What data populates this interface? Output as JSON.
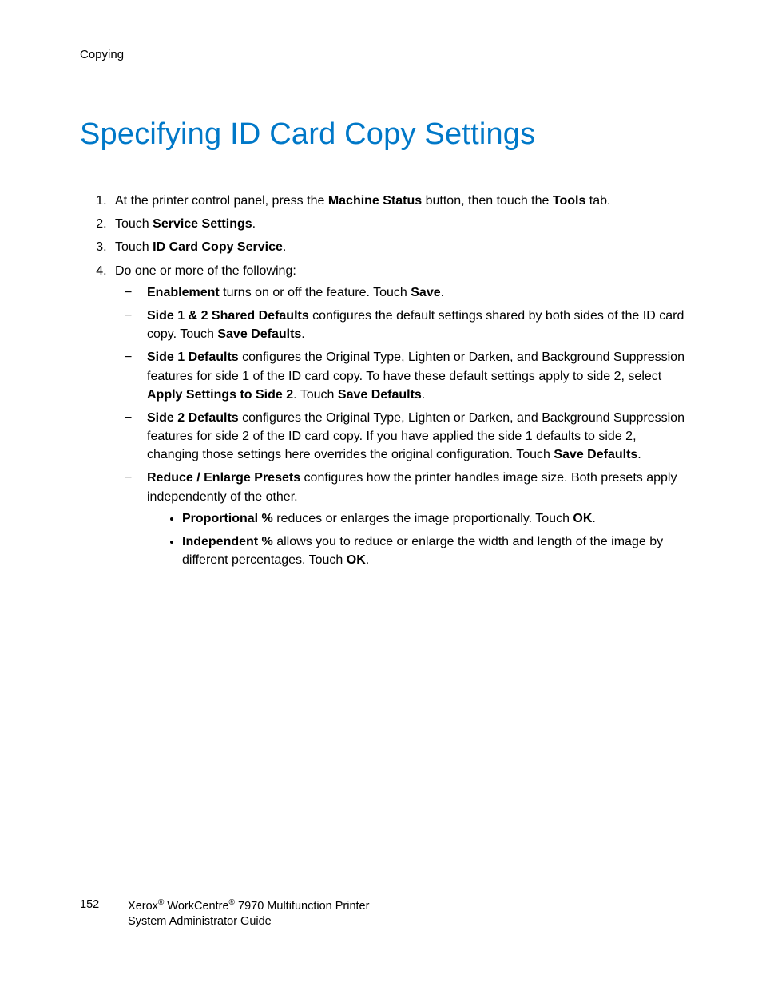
{
  "header": {
    "section": "Copying"
  },
  "title": "Specifying ID Card Copy Settings",
  "steps": [
    {
      "parts": [
        {
          "t": "plain",
          "v": "At the printer control panel, press the "
        },
        {
          "t": "b",
          "v": "Machine Status"
        },
        {
          "t": "plain",
          "v": " button, then touch the "
        },
        {
          "t": "b",
          "v": "Tools"
        },
        {
          "t": "plain",
          "v": " tab."
        }
      ]
    },
    {
      "parts": [
        {
          "t": "plain",
          "v": "Touch "
        },
        {
          "t": "b",
          "v": "Service Settings"
        },
        {
          "t": "plain",
          "v": "."
        }
      ]
    },
    {
      "parts": [
        {
          "t": "plain",
          "v": "Touch "
        },
        {
          "t": "b",
          "v": "ID Card Copy Service"
        },
        {
          "t": "plain",
          "v": "."
        }
      ]
    },
    {
      "parts": [
        {
          "t": "plain",
          "v": "Do one or more of the following:"
        }
      ],
      "dash": [
        {
          "parts": [
            {
              "t": "b",
              "v": "Enablement"
            },
            {
              "t": "plain",
              "v": " turns on or off the feature. Touch "
            },
            {
              "t": "b",
              "v": "Save"
            },
            {
              "t": "plain",
              "v": "."
            }
          ]
        },
        {
          "parts": [
            {
              "t": "b",
              "v": "Side 1 & 2 Shared Defaults"
            },
            {
              "t": "plain",
              "v": " configures the default settings shared by both sides of the ID card copy. Touch "
            },
            {
              "t": "b",
              "v": "Save Defaults"
            },
            {
              "t": "plain",
              "v": "."
            }
          ]
        },
        {
          "parts": [
            {
              "t": "b",
              "v": "Side 1 Defaults"
            },
            {
              "t": "plain",
              "v": " configures the Original Type, Lighten or Darken, and Background Suppression features for side 1 of the ID card copy. To have these default settings apply to side 2, select "
            },
            {
              "t": "b",
              "v": "Apply Settings to Side 2"
            },
            {
              "t": "plain",
              "v": ". Touch "
            },
            {
              "t": "b",
              "v": "Save Defaults"
            },
            {
              "t": "plain",
              "v": "."
            }
          ]
        },
        {
          "parts": [
            {
              "t": "b",
              "v": "Side 2 Defaults"
            },
            {
              "t": "plain",
              "v": " configures the Original Type, Lighten or Darken, and Background Suppression features for side 2 of the ID card copy. If you have applied the side 1 defaults to side 2, changing those settings here overrides the original configuration. Touch "
            },
            {
              "t": "b",
              "v": "Save Defaults"
            },
            {
              "t": "plain",
              "v": "."
            }
          ]
        },
        {
          "parts": [
            {
              "t": "b",
              "v": "Reduce / Enlarge Presets"
            },
            {
              "t": "plain",
              "v": " configures how the printer handles image size. Both presets apply independently of the other."
            }
          ],
          "bullets": [
            {
              "parts": [
                {
                  "t": "b",
                  "v": "Proportional %"
                },
                {
                  "t": "plain",
                  "v": " reduces or enlarges the image proportionally. Touch "
                },
                {
                  "t": "b",
                  "v": "OK"
                },
                {
                  "t": "plain",
                  "v": "."
                }
              ]
            },
            {
              "parts": [
                {
                  "t": "b",
                  "v": "Independent %"
                },
                {
                  "t": "plain",
                  "v": " allows you to reduce or enlarge the width and length of the image by different percentages. Touch "
                },
                {
                  "t": "b",
                  "v": "OK"
                },
                {
                  "t": "plain",
                  "v": "."
                }
              ]
            }
          ]
        }
      ]
    }
  ],
  "footer": {
    "page": "152",
    "line1_parts": [
      {
        "t": "plain",
        "v": "Xerox"
      },
      {
        "t": "sup",
        "v": "®"
      },
      {
        "t": "plain",
        "v": " WorkCentre"
      },
      {
        "t": "sup",
        "v": "®"
      },
      {
        "t": "plain",
        "v": " 7970 Multifunction Printer"
      }
    ],
    "line2": "System Administrator Guide"
  }
}
